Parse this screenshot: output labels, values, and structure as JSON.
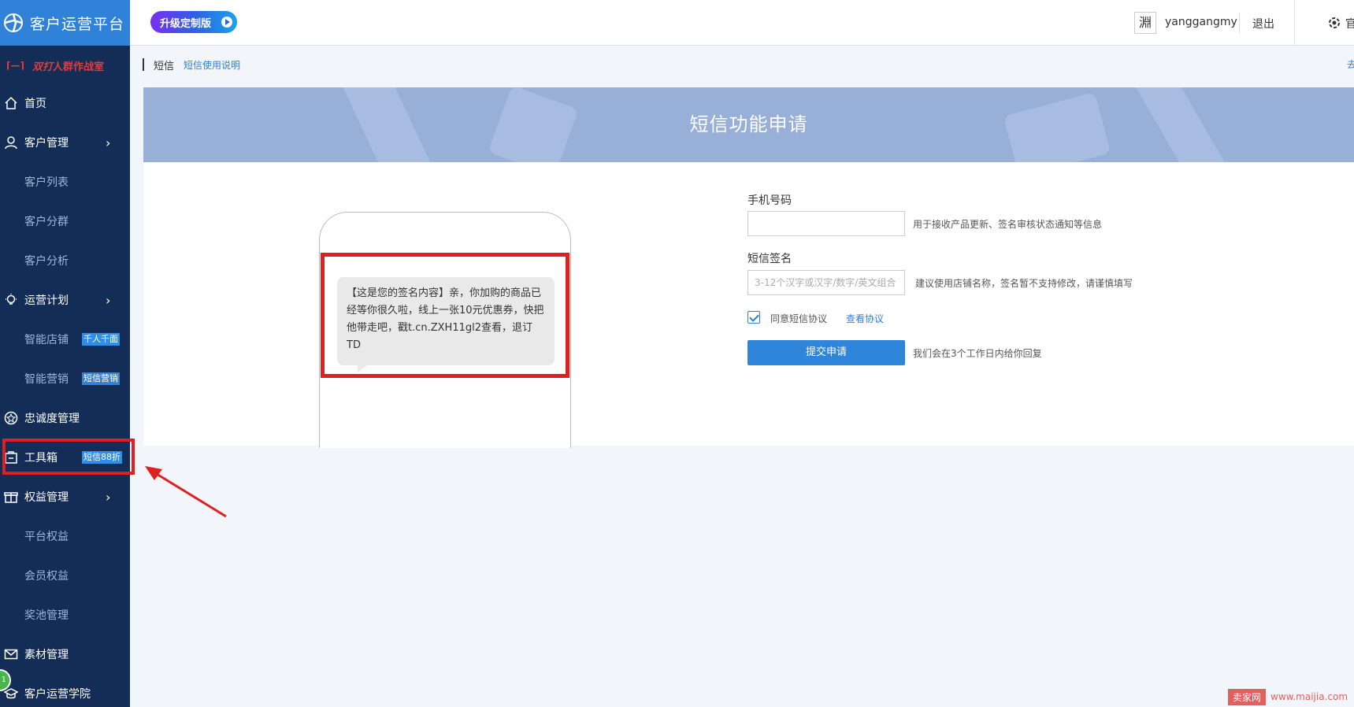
{
  "app": {
    "title": "客户运营平台",
    "upgrade_label": "升级定制版"
  },
  "promo": {
    "prefix": "⌈—⌉",
    "part1": "双打",
    "part2": "人群作战室"
  },
  "sidebar": {
    "items": [
      {
        "label": "首页",
        "icon": "home-icon"
      },
      {
        "label": "客户管理",
        "icon": "user-icon",
        "arrow": "›"
      },
      {
        "label": "客户列表"
      },
      {
        "label": "客户分群"
      },
      {
        "label": "客户分析"
      },
      {
        "label": "运营计划",
        "icon": "bulb-icon",
        "arrow": "›"
      },
      {
        "label": "智能店铺",
        "badge": "千人千面"
      },
      {
        "label": "智能营销",
        "badge": "短信营销"
      },
      {
        "label": "忠诚度管理",
        "icon": "star-icon"
      },
      {
        "label": "工具箱",
        "icon": "toolbox-icon",
        "badge": "短信88折"
      },
      {
        "label": "权益管理",
        "icon": "gift-icon",
        "arrow": "›"
      },
      {
        "label": "平台权益"
      },
      {
        "label": "会员权益"
      },
      {
        "label": "奖池管理"
      },
      {
        "label": "素材管理",
        "icon": "mail-icon"
      },
      {
        "label": "客户运营学院",
        "icon": "academy-icon"
      }
    ]
  },
  "header": {
    "username": "yanggangmy",
    "logout": "退出",
    "settings_label": "官",
    "avatar_text": "淵"
  },
  "breadcrumb": {
    "current": "短信",
    "link": "短信使用说明",
    "right_link": "去"
  },
  "banner": {
    "title": "短信功能申请"
  },
  "preview": {
    "sms_text": "【这是您的签名内容】亲，你加购的商品已经等你很久啦，线上一张10元优惠券，快把他带走吧，戳t.cn.ZXH11gl2查看，退订TD"
  },
  "form": {
    "phone_label": "手机号码",
    "phone_value": "",
    "phone_hint": "用于接收产品更新、签名审核状态通知等信息",
    "sign_label": "短信签名",
    "sign_placeholder": "3-12个汉字或汉字/数字/英文组合",
    "sign_hint": "建议使用店铺名称，签名暂不支持修改，请谨慎填写",
    "agree_label": "同意短信协议",
    "agree_link": "查看协议",
    "submit_label": "提交申请",
    "submit_hint": "我们会在3个工作日内给你回复"
  },
  "watermark": {
    "brand": "卖家网",
    "url": "www.maijia.com"
  },
  "float_badge": "1",
  "colors": {
    "sidebar": "#132d56",
    "brand": "#2f82d8",
    "highlight": "#e02020",
    "banner": "#98afd7",
    "accent": "#2f85da"
  }
}
